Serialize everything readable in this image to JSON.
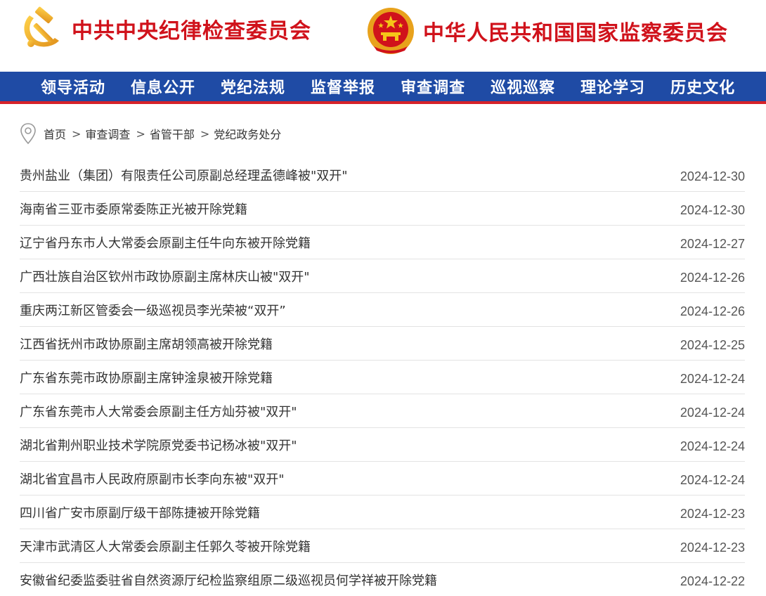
{
  "header": {
    "cpc_title": "中共中央纪律检查委员会",
    "state_title": "中华人民共和国国家监察委员会",
    "brand_color": "#d0121b"
  },
  "nav": {
    "items": [
      "领导活动",
      "信息公开",
      "党纪法规",
      "监督举报",
      "审查调查",
      "巡视巡察",
      "理论学习",
      "历史文化"
    ],
    "bg_color": "#1f4ba5",
    "underline_color": "#d6222a"
  },
  "breadcrumb": {
    "icon": "location-pin-icon",
    "items": [
      "首页",
      "审查调查",
      "省管干部",
      "党纪政务处分"
    ],
    "separator": ">"
  },
  "articles": [
    {
      "title": "贵州盐业（集团）有限责任公司原副总经理孟德峰被\"双开\"",
      "date": "2024-12-30"
    },
    {
      "title": "海南省三亚市委原常委陈正光被开除党籍",
      "date": "2024-12-30"
    },
    {
      "title": "辽宁省丹东市人大常委会原副主任牛向东被开除党籍",
      "date": "2024-12-27"
    },
    {
      "title": "广西壮族自治区钦州市政协原副主席林庆山被\"双开\"",
      "date": "2024-12-26"
    },
    {
      "title": "重庆两江新区管委会一级巡视员李光荣被“双开”",
      "date": "2024-12-26"
    },
    {
      "title": "江西省抚州市政协原副主席胡领高被开除党籍",
      "date": "2024-12-25"
    },
    {
      "title": "广东省东莞市政协原副主席钟淦泉被开除党籍",
      "date": "2024-12-24"
    },
    {
      "title": "广东省东莞市人大常委会原副主任方灿芬被\"双开\"",
      "date": "2024-12-24"
    },
    {
      "title": "湖北省荆州职业技术学院原党委书记杨冰被\"双开\"",
      "date": "2024-12-24"
    },
    {
      "title": "湖北省宜昌市人民政府原副市长李向东被\"双开\"",
      "date": "2024-12-24"
    },
    {
      "title": "四川省广安市原副厅级干部陈捷被开除党籍",
      "date": "2024-12-23"
    },
    {
      "title": "天津市武清区人大常委会原副主任郭久苓被开除党籍",
      "date": "2024-12-23"
    },
    {
      "title": "安徽省纪委监委驻省自然资源厅纪检监察组原二级巡视员何学祥被开除党籍",
      "date": "2024-12-22"
    }
  ]
}
